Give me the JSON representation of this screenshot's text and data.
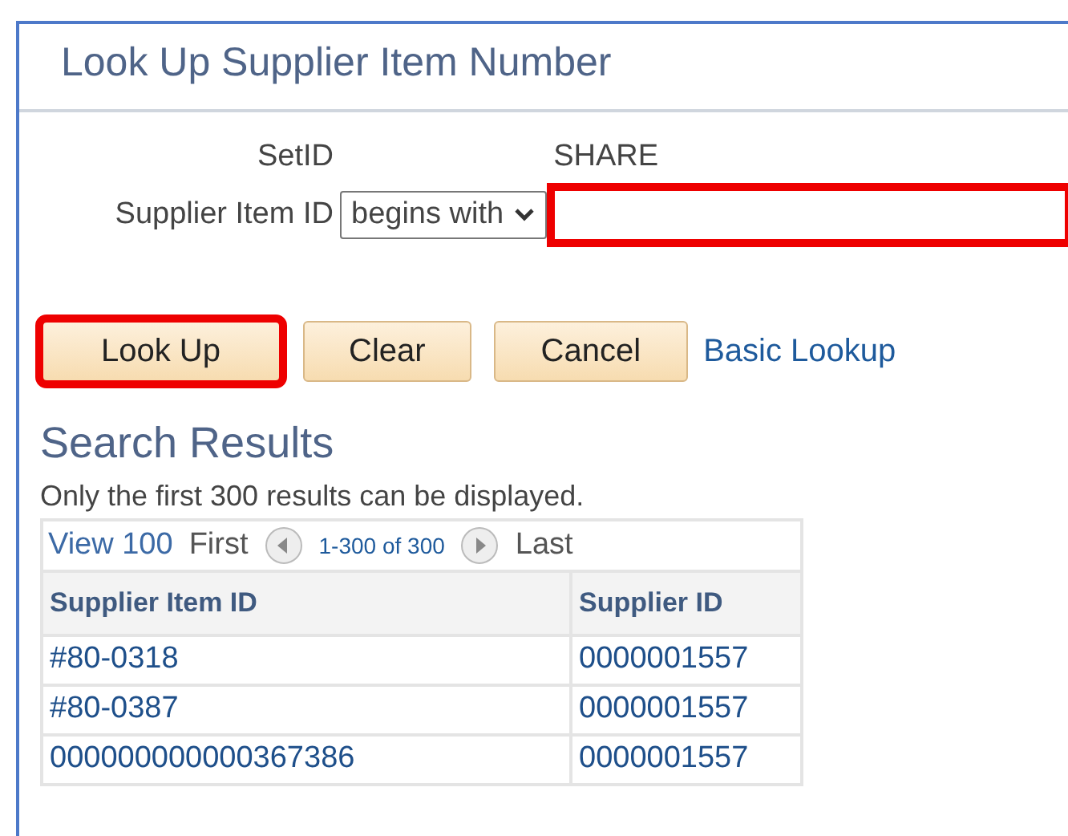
{
  "window": {
    "title": "Look Up Supplier Item Number"
  },
  "criteria": {
    "setid_label": "SetID",
    "setid_value": "SHARE",
    "field_label": "Supplier Item ID",
    "operator": "begins with",
    "highlighted": true
  },
  "buttons": [
    {
      "label": "Look Up",
      "kind": "button",
      "highlighted": true
    },
    {
      "label": "Clear",
      "kind": "button",
      "highlighted": false
    },
    {
      "label": "Cancel",
      "kind": "button",
      "highlighted": false
    },
    {
      "label": "Basic Lookup",
      "kind": "link",
      "highlighted": false
    }
  ],
  "results": {
    "heading": "Search Results",
    "note": "Only the first 300 results can be displayed.",
    "pager": {
      "view": "View 100",
      "first": "First",
      "range": "1-300 of 300",
      "last": "Last"
    },
    "columns": [
      "Supplier Item ID",
      "Supplier ID"
    ],
    "rows": [
      [
        "#80-0318",
        "0000001557"
      ],
      [
        "#80-0387",
        "0000001557"
      ],
      [
        "000000000000367386",
        "0000001557"
      ]
    ]
  }
}
